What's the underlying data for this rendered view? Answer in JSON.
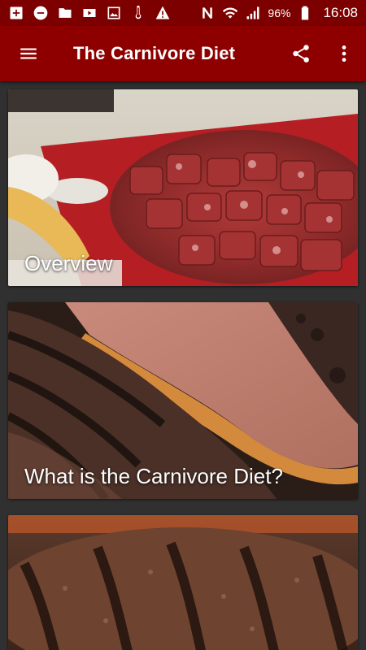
{
  "status_bar": {
    "battery": "96%",
    "time": "16:08",
    "icons": [
      "add-box-icon",
      "minus-circle-icon",
      "folder-icon",
      "youtube-icon",
      "image-icon",
      "thermometer-icon",
      "warning-icon",
      "nfc-icon",
      "wifi-icon",
      "signal-icon",
      "battery-icon"
    ]
  },
  "app_bar": {
    "title": "The Carnivore Diet",
    "icons": [
      "menu-icon",
      "share-icon",
      "more-vert-icon"
    ]
  },
  "cards": [
    {
      "label": "Overview"
    },
    {
      "label": "What is the Carnivore Diet?"
    },
    {
      "label": ""
    }
  ],
  "colors": {
    "status_bar": "#7d0000",
    "app_bar": "#8e0000",
    "background": "#303030"
  }
}
